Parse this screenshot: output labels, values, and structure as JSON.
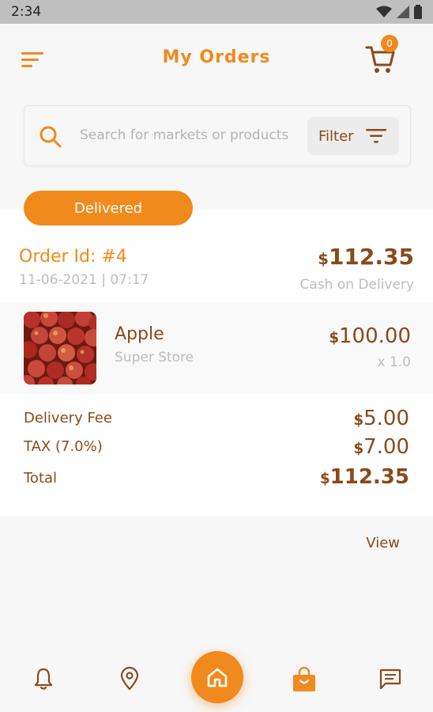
{
  "status_bar": {
    "time": "2:34"
  },
  "header": {
    "title": "My Orders",
    "cart_count": "0"
  },
  "search": {
    "placeholder": "Search for markets or products",
    "filter_label": "Filter"
  },
  "order": {
    "status": "Delivered",
    "id_label": "Order Id: #4",
    "date": "11-06-2021 | 07:17",
    "total_currency": "$",
    "total_amount": "112.35",
    "payment_method": "Cash on Delivery",
    "items": [
      {
        "name": "Apple",
        "store": "Super Store",
        "price_currency": "$",
        "price_amount": "100.00",
        "quantity": "x 1.0"
      }
    ],
    "summary": {
      "delivery_fee_label": "Delivery Fee",
      "delivery_fee_currency": "$",
      "delivery_fee_amount": "5.00",
      "tax_label": "TAX (7.0%)",
      "tax_currency": "$",
      "tax_amount": "7.00",
      "total_label": "Total",
      "total_currency": "$",
      "total_amount": "112.35"
    },
    "view_label": "View"
  },
  "bottom_nav": {
    "items": [
      {
        "icon": "bell-icon"
      },
      {
        "icon": "map-pin-icon"
      },
      {
        "icon": "home-icon"
      },
      {
        "icon": "shopping-bag-icon"
      },
      {
        "icon": "chat-icon"
      }
    ]
  },
  "colors": {
    "accent": "#f08a1c",
    "text_brown": "#8a4a1a",
    "muted": "#bdbdbd"
  }
}
